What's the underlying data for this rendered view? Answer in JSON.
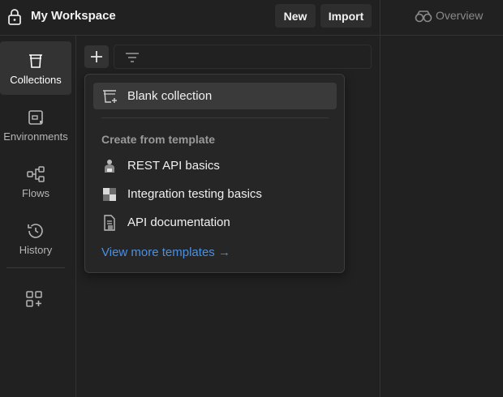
{
  "header": {
    "workspace_title": "My Workspace",
    "new_label": "New",
    "import_label": "Import",
    "lock_icon": "lock-icon"
  },
  "overview": {
    "label": "Overview",
    "icon": "overview-icon"
  },
  "sidebar": {
    "items": [
      {
        "label": "Collections",
        "icon": "collections-icon",
        "active": true
      },
      {
        "label": "Environments",
        "icon": "environments-icon",
        "active": false
      },
      {
        "label": "Flows",
        "icon": "flows-icon",
        "active": false
      },
      {
        "label": "History",
        "icon": "history-icon",
        "active": false
      }
    ],
    "add_icon": "add-workbench-icon"
  },
  "toolbar": {
    "plus_icon": "plus-icon",
    "filter_icon": "filter-icon"
  },
  "menu": {
    "blank_collection": "Blank collection",
    "template_heading": "Create from template",
    "templates": [
      {
        "label": "REST API basics",
        "icon": "rest-api-icon"
      },
      {
        "label": "Integration testing basics",
        "icon": "integration-testing-icon"
      },
      {
        "label": "API documentation",
        "icon": "api-documentation-icon"
      }
    ],
    "view_more": "View more templates →"
  },
  "colors": {
    "background": "#212121",
    "active_item": "#333333",
    "link": "#4a90e2",
    "text": "#f0f0f0",
    "muted_text": "#9a9a9a"
  }
}
